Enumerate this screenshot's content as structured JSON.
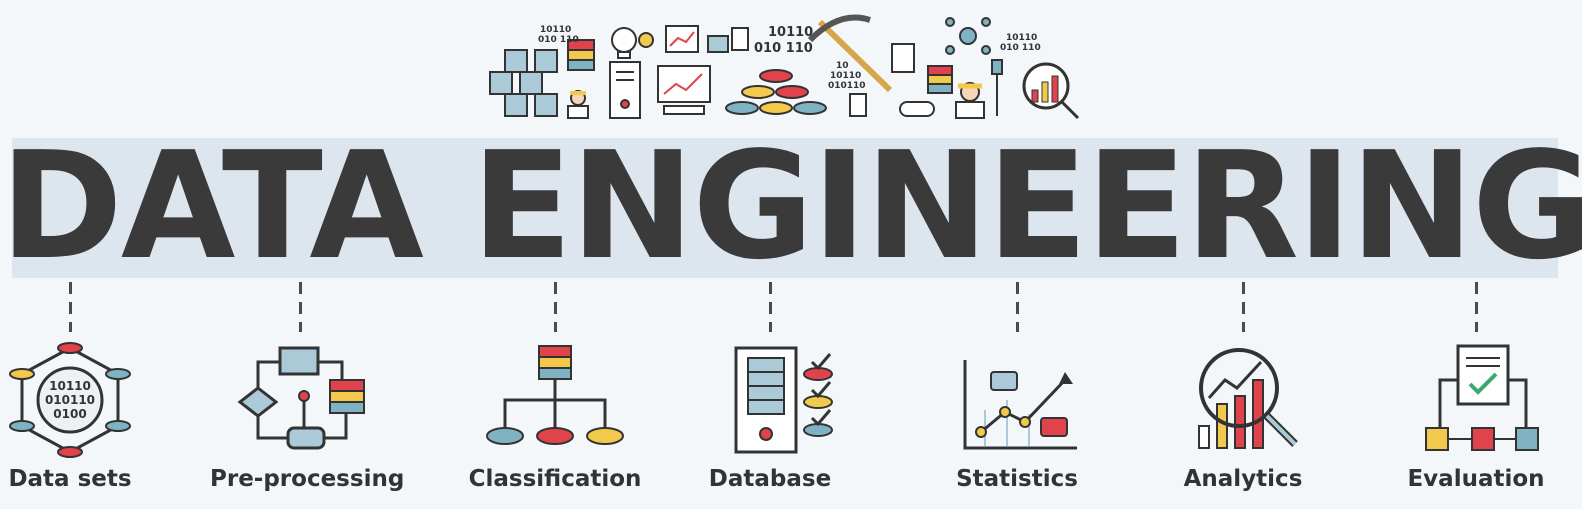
{
  "title": "DATA ENGINEERING",
  "hero": {
    "binary_1": "10110",
    "binary_2": "010 110",
    "binary_3": "10110",
    "binary_4": "010 110",
    "binary_5": "10110",
    "binary_6": "010 110",
    "binary_7": "10",
    "binary_8": "10110",
    "binary_9": "010110"
  },
  "categories": [
    {
      "label": "Data sets",
      "icon": "network-icon",
      "binary": [
        "10110",
        "010110",
        "0100"
      ]
    },
    {
      "label": "Pre-processing",
      "icon": "flow-icon"
    },
    {
      "label": "Classification",
      "icon": "hierarchy-icon"
    },
    {
      "label": "Database",
      "icon": "server-icon"
    },
    {
      "label": "Statistics",
      "icon": "line-chart-icon"
    },
    {
      "label": "Analytics",
      "icon": "magnifier-chart-icon"
    },
    {
      "label": "Evaluation",
      "icon": "checklist-icon"
    }
  ],
  "colors": {
    "red": "#e0434b",
    "yellow": "#f2c94c",
    "teal": "#7fb3c4",
    "dark": "#3a3a3a",
    "banner": "#dde5ee"
  }
}
